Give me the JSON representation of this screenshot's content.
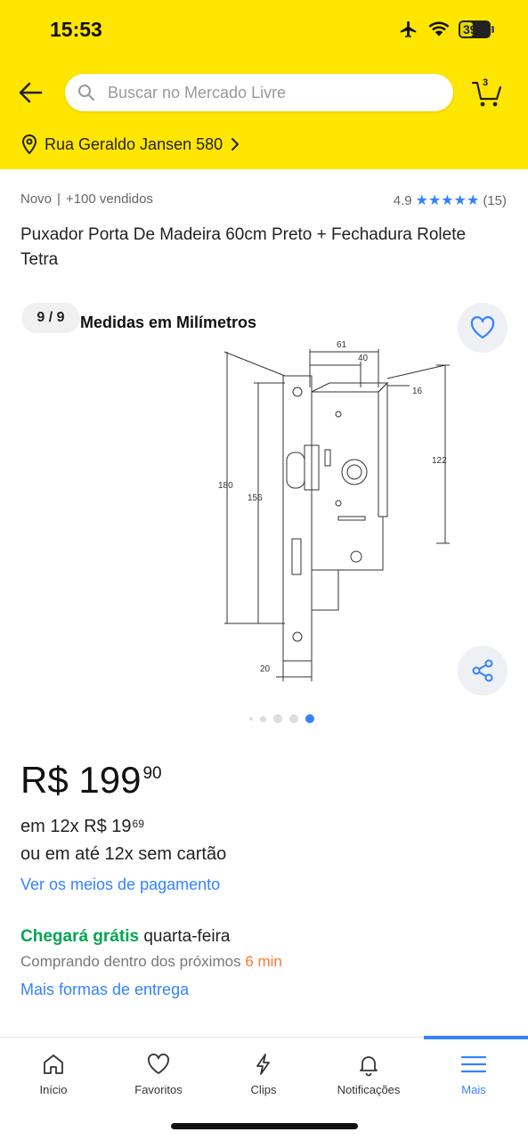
{
  "status_bar": {
    "time": "15:53",
    "battery": "39",
    "icons": [
      "airplane-icon",
      "wifi-icon",
      "battery-icon"
    ]
  },
  "header": {
    "search_placeholder": "Buscar no Mercado Livre",
    "cart_count": "3",
    "address": "Rua Geraldo Jansen 580"
  },
  "product": {
    "condition": "Novo",
    "sold": "+100 vendidos",
    "rating": "4.9",
    "stars": "★★★★★",
    "reviews": "(15)",
    "title": "Puxador Porta De Madeira 60cm Preto + Fechadura Rolete Tetra"
  },
  "gallery": {
    "counter": "9 / 9",
    "caption": "Medidas em Milímetros",
    "dimensions": {
      "d61": "61",
      "d40": "40",
      "d16": "16",
      "d180": "180",
      "d156": "156",
      "d122": "122",
      "d20": "20"
    },
    "page_count": 5,
    "current_page": 5
  },
  "pricing": {
    "currency": "R$",
    "price_int": "199",
    "price_cents": "90",
    "installments_prefix": "em 12x R$ 19",
    "installments_cents": "69",
    "no_card": "ou em até 12x sem cartão",
    "payment_link": "Ver os meios de pagamento"
  },
  "shipping": {
    "free_label": "Chegará grátis",
    "day": "quarta-feira",
    "purchase_within": "Comprando dentro dos próximos",
    "minutes": "6 min",
    "more_options": "Mais formas de entrega"
  },
  "tabbar": {
    "items": [
      {
        "label": "Início",
        "icon": "home-icon"
      },
      {
        "label": "Favoritos",
        "icon": "heart-icon"
      },
      {
        "label": "Clips",
        "icon": "lightning-icon"
      },
      {
        "label": "Notificações",
        "icon": "bell-icon"
      },
      {
        "label": "Mais",
        "icon": "menu-icon"
      }
    ],
    "active": "Mais"
  },
  "colors": {
    "header_yellow": "#ffe600",
    "link_blue": "#3483fa",
    "green": "#00a650",
    "orange": "#ff7733"
  }
}
